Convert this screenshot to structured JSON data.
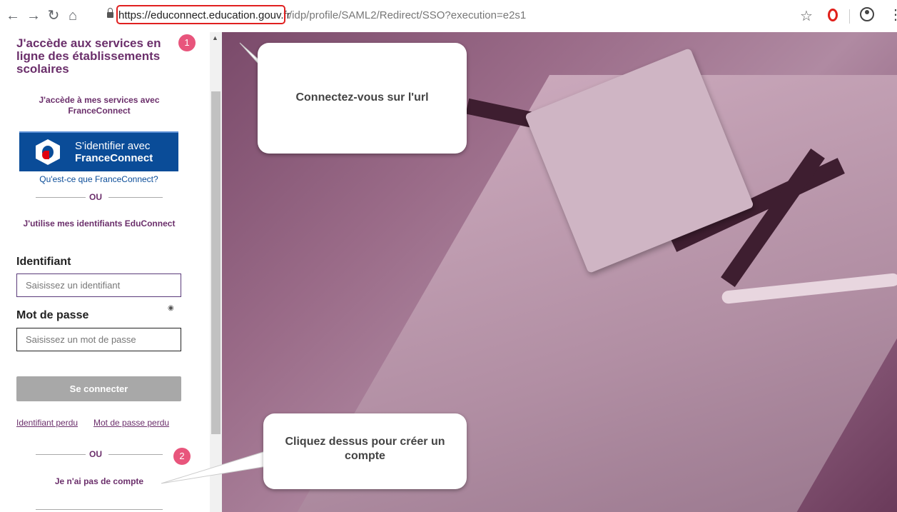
{
  "browser": {
    "back_icon": "arrow-left-icon",
    "forward_icon": "arrow-right-icon",
    "reload_icon": "reload-icon",
    "home_icon": "home-icon",
    "url_host": "https://educonnect.education.gouv.fr",
    "url_path": "/idp/profile/SAML2/Redirect/SSO?execution=e2s1"
  },
  "panel": {
    "title": "J'accède aux services en ligne des établissements scolaires",
    "fc_heading": "J'accède à mes services avec FranceConnect",
    "fc_button_line1": "S'identifier avec",
    "fc_button_line2": "FranceConnect",
    "fc_link": "Qu'est-ce que FranceConnect?",
    "separator": "OU",
    "educonnect_heading": "J'utilise mes identifiants EduConnect",
    "id_label": "Identifiant",
    "id_placeholder": "Saisissez un identifiant",
    "pwd_label": "Mot de passe",
    "pwd_placeholder": "Saisissez un mot de passe",
    "connect_button": "Se connecter",
    "lost_id": "Identifiant perdu",
    "lost_pwd": "Mot de passe perdu",
    "no_account": "Je n'ai pas de compte"
  },
  "annotations": {
    "badge1": "1",
    "badge2": "2",
    "callout1": "Connectez-vous sur l'url",
    "callout2": "Cliquez dessus pour créer un compte"
  },
  "colors": {
    "accent": "#6b2f6b",
    "franceconnect": "#0a4c98",
    "badge": "#e8557c",
    "highlight": "#e02020"
  }
}
